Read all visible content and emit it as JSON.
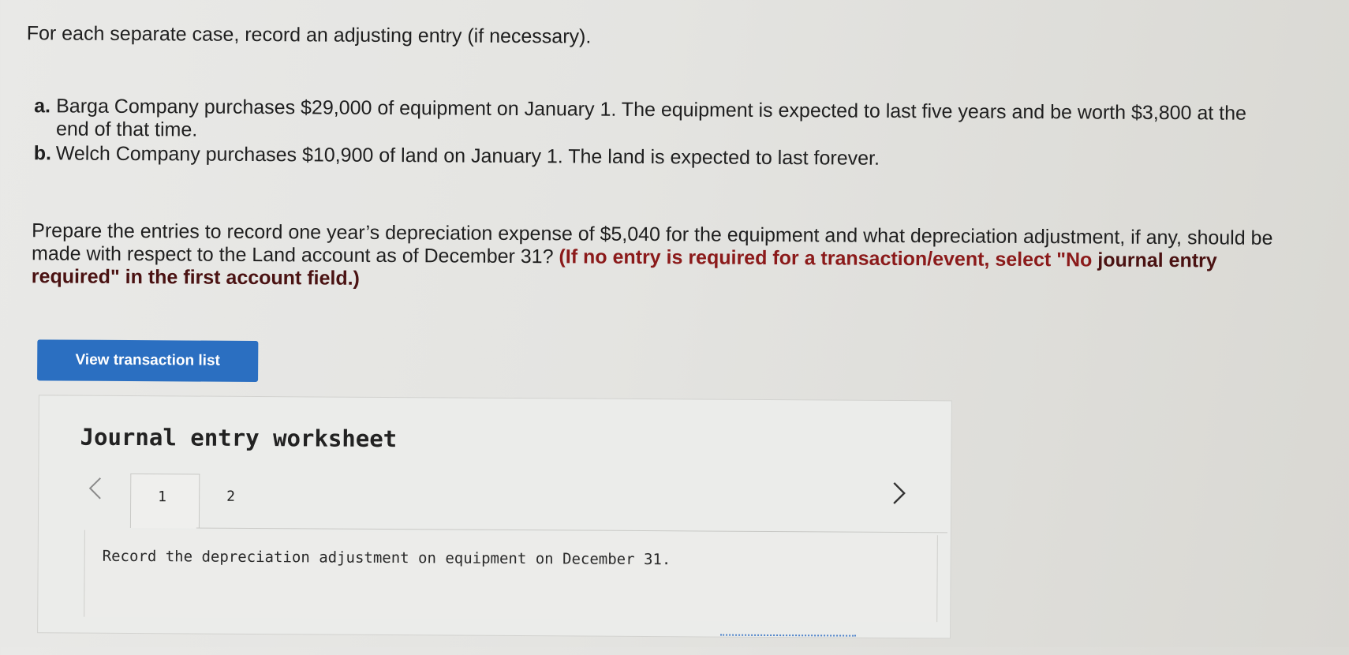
{
  "instruction": "For each separate case, record an adjusting entry (if necessary).",
  "cases": [
    {
      "letter": "a.",
      "text": "Barga Company purchases $29,000 of equipment on January 1. The equipment is expected to last five years and be worth $3,800 at the end of that time."
    },
    {
      "letter": "b.",
      "text": "Welch Company purchases $10,900 of land on January 1. The land is expected to last forever."
    }
  ],
  "prepare": {
    "text": "Prepare the entries to record one year’s depreciation expense of $5,040 for the equipment and what depreciation adjustment, if any, should be made with respect to the Land account as of December 31?",
    "note_part1": "(If no entry is required for a transaction/event, select \"No",
    "note_part2": "journal entry required\" in the first account field.)"
  },
  "view_button": {
    "label": "View transaction list"
  },
  "worksheet": {
    "title": "Journal entry worksheet",
    "prev_icon": "chevron-left-icon",
    "next_icon": "chevron-right-icon",
    "tabs": [
      "1",
      "2"
    ],
    "active_tab": "1",
    "record_text": "Record the depreciation adjustment on equipment on December 31."
  }
}
